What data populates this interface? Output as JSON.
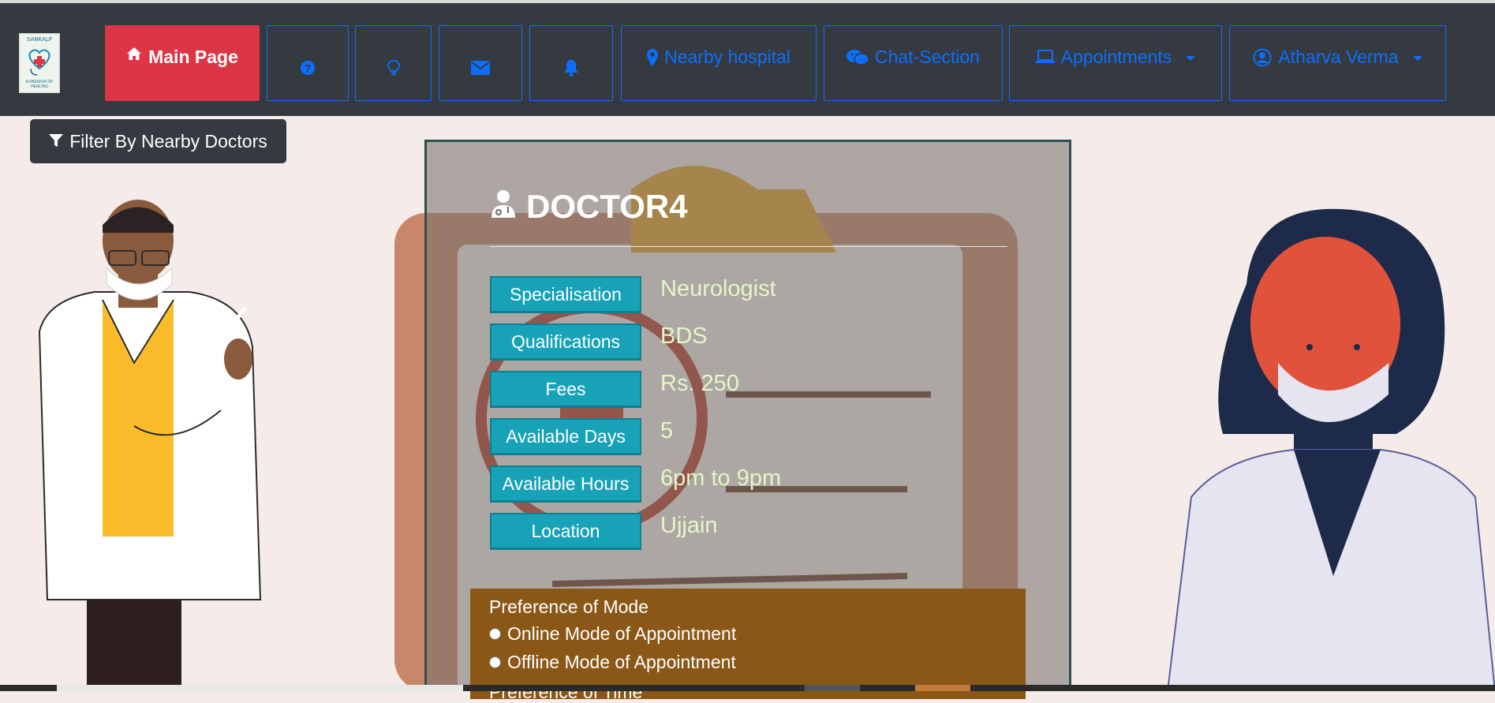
{
  "logo": {
    "top_text": "SANKALP",
    "bottom_text": "A PASSION OF HEALING"
  },
  "nav": {
    "main_page": "Main Page",
    "nearby_hospital": "Nearby hospital",
    "chat_section": "Chat-Section",
    "appointments": "Appointments",
    "user": "Atharva Verma",
    "icons": [
      "home-icon",
      "question-circle-icon",
      "lightbulb-icon",
      "envelope-icon",
      "bell-icon",
      "map-marker-icon",
      "wechat-icon",
      "laptop-icon",
      "user-circle-icon"
    ]
  },
  "filter_button": "Filter By Nearby Doctors",
  "doctor": {
    "name": "DOCTOR4",
    "fields": [
      {
        "label": "Specialisation",
        "value": "Neurologist"
      },
      {
        "label": "Qualifications",
        "value": "BDS"
      },
      {
        "label": "Fees",
        "value": "Rs. 250"
      },
      {
        "label": "Available Days",
        "value": "5"
      },
      {
        "label": "Available Hours",
        "value": "6pm to 9pm"
      },
      {
        "label": "Location",
        "value": "Ujjain"
      }
    ]
  },
  "preference": {
    "mode_heading": "Preference of Mode",
    "online": "Online Mode of Appointment",
    "offline": "Offline Mode of Appointment",
    "time_heading": "Preference of Time"
  },
  "colors": {
    "navbar": "#343a40",
    "primary": "#0d6efd",
    "danger": "#dc3545",
    "info": "#17a2b8",
    "value_text": "#e3f7c8",
    "pref_bg": "#8b5716"
  }
}
